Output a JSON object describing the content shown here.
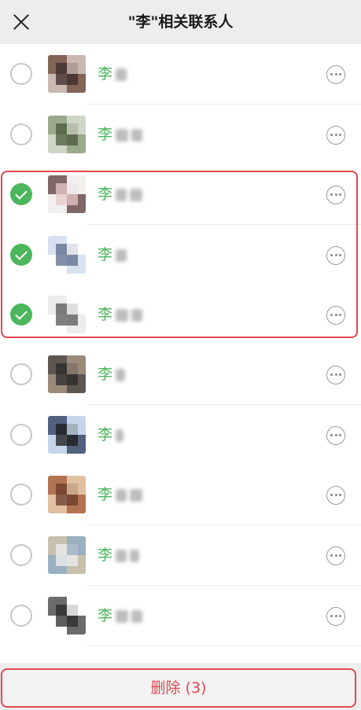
{
  "header": {
    "title": "\"李\"相关联系人",
    "close_icon": "close-icon"
  },
  "contacts": [
    {
      "surname": "李",
      "checked": false,
      "avatar_colors": [
        "#6b4a3a",
        "#c9b9b0",
        "#3a2a2a"
      ]
    },
    {
      "surname": "李",
      "checked": false,
      "avatar_colors": [
        "#8a9a7a",
        "#d0d6c6",
        "#4a5a3a"
      ]
    },
    {
      "surname": "李",
      "checked": true,
      "avatar_colors": [
        "#5a3a3a",
        "#f2efef",
        "#e9c9c9"
      ]
    },
    {
      "surname": "李",
      "checked": true,
      "avatar_colors": [
        "#c9d7ea",
        "#ffffff",
        "#5a6a8a"
      ]
    },
    {
      "surname": "李",
      "checked": true,
      "avatar_colors": [
        "#e6e6e6",
        "#ffffff",
        "#555555"
      ]
    },
    {
      "surname": "李",
      "checked": false,
      "avatar_colors": [
        "#4a4444",
        "#9a8a7a",
        "#2a2a2a"
      ]
    },
    {
      "surname": "李",
      "checked": false,
      "avatar_colors": [
        "#2a3a5a",
        "#c6d6ea",
        "#1a1a1a"
      ]
    },
    {
      "surname": "李",
      "checked": false,
      "avatar_colors": [
        "#a45a3a",
        "#e0c0a0",
        "#6a3a2a"
      ]
    },
    {
      "surname": "李",
      "checked": false,
      "avatar_colors": [
        "#d6c6a6",
        "#9ab0c0",
        "#f0f0f0"
      ]
    },
    {
      "surname": "李",
      "checked": false,
      "avatar_colors": [
        "#3a3a3a",
        "#ffffff",
        "#2a2a2a"
      ]
    }
  ],
  "footer": {
    "delete_label": "删除 (3)"
  },
  "colors": {
    "accent_green": "#4bb65c",
    "highlight_red": "#e04850"
  }
}
